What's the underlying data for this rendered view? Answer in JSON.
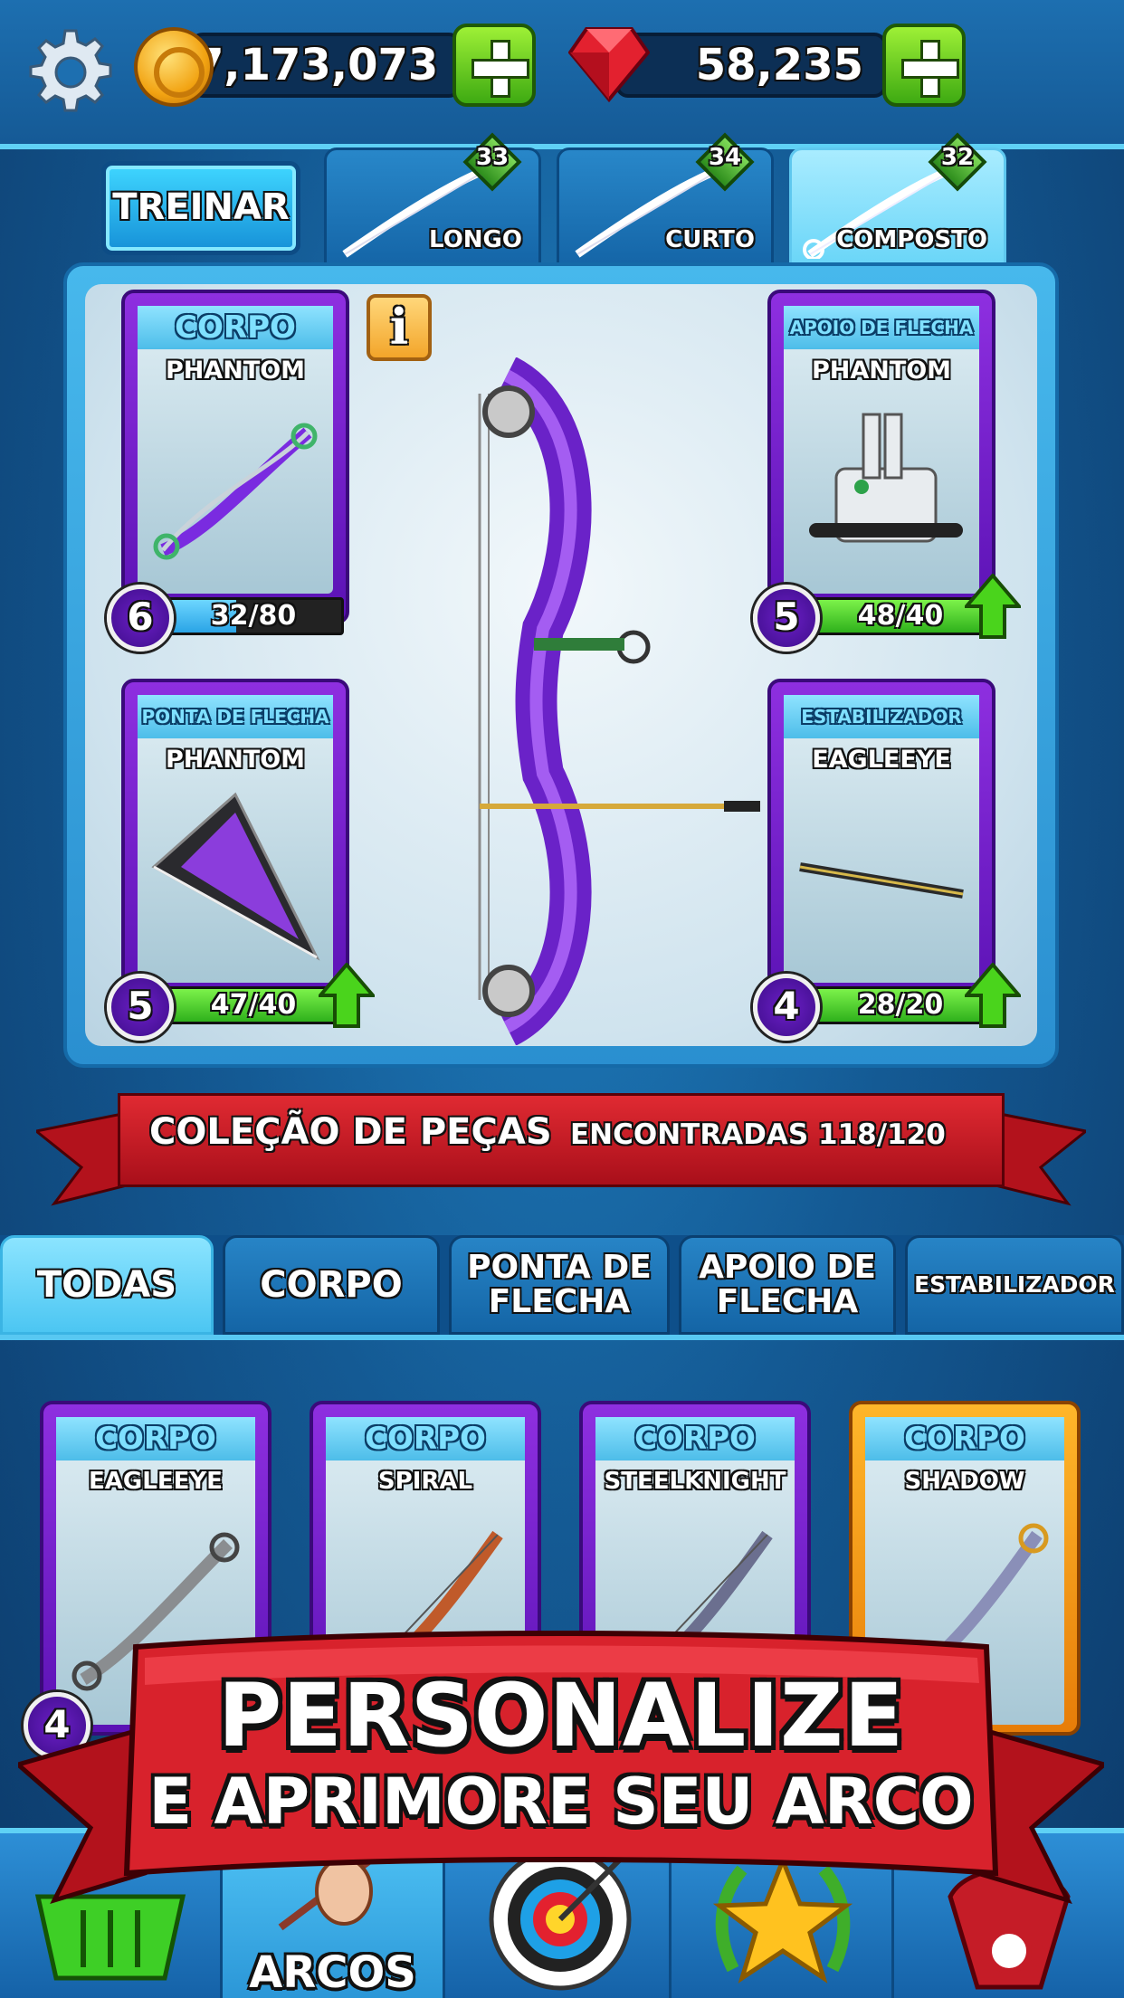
{
  "header": {
    "coins": "7,173,073",
    "gems": "58,235"
  },
  "bow_tabs": {
    "train_label": "TREINAR",
    "tabs": [
      {
        "label": "LONGO",
        "level": "33"
      },
      {
        "label": "CURTO",
        "level": "34"
      },
      {
        "label": "COMPOSTO",
        "level": "32",
        "active": true
      }
    ]
  },
  "equipped": {
    "info_label": "i",
    "parts": [
      {
        "category": "CORPO",
        "name": "PHANTOM",
        "level": "6",
        "progress": "32/80",
        "fill": 0.4,
        "upgrade": false
      },
      {
        "category": "APOIO DE FLECHA",
        "name": "PHANTOM",
        "level": "5",
        "progress": "48/40",
        "fill": 1.0,
        "upgrade": true
      },
      {
        "category": "PONTA DE FLECHA",
        "name": "PHANTOM",
        "level": "5",
        "progress": "47/40",
        "fill": 1.0,
        "upgrade": true
      },
      {
        "category": "ESTABILIZADOR",
        "name": "EAGLEEYE",
        "level": "4",
        "progress": "28/20",
        "fill": 1.0,
        "upgrade": true
      }
    ]
  },
  "collection": {
    "title": "COLEÇÃO DE PEÇAS",
    "found": "ENCONTRADAS 118/120"
  },
  "category_tabs": [
    {
      "line1": "TODAS",
      "line2": "",
      "active": true
    },
    {
      "line1": "CORPO",
      "line2": ""
    },
    {
      "line1": "PONTA DE",
      "line2": "FLECHA"
    },
    {
      "line1": "APOIO DE",
      "line2": "FLECHA"
    },
    {
      "line1": "ESTABILIZADOR",
      "line2": ""
    }
  ],
  "collection_cards": [
    {
      "category": "CORPO",
      "name": "EAGLEEYE",
      "level": "4"
    },
    {
      "category": "CORPO",
      "name": "SPIRAL"
    },
    {
      "category": "CORPO",
      "name": "STEELKNIGHT"
    },
    {
      "category": "CORPO",
      "name": "SHADOW",
      "rarity": "gold"
    }
  ],
  "banner": {
    "line1": "PERSONALIZE",
    "line2": "E APRIMORE SEU ARCO"
  },
  "nav": {
    "items": [
      {
        "label": "",
        "icon": "basket-icon"
      },
      {
        "label": "ARCOS",
        "icon": "bow-hand-icon",
        "active": true
      },
      {
        "label": "",
        "icon": "target-icon"
      },
      {
        "label": "",
        "icon": "star-wreath-icon"
      },
      {
        "label": "",
        "icon": "trophy-badge-icon"
      }
    ]
  },
  "colors": {
    "progress_green": "#3ccf2a",
    "progress_blue": "#35b8f0",
    "card_purple": "#7a22d4",
    "card_gold": "#f29a16",
    "ribbon_red": "#d0202a"
  }
}
